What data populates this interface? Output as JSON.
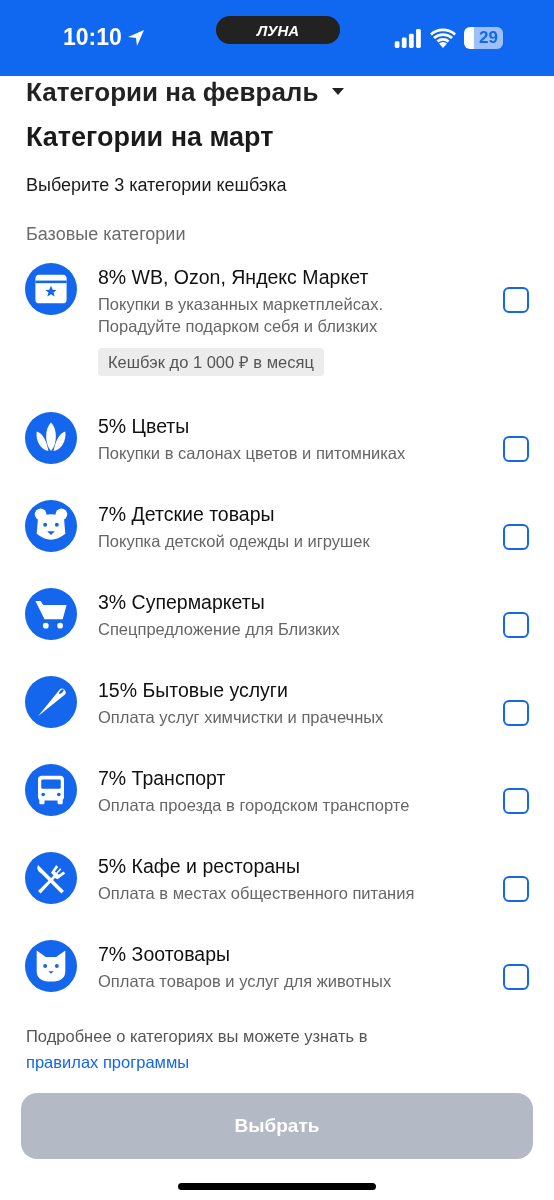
{
  "status_bar": {
    "time": "10:10",
    "carrier_logo": "ЛУНА",
    "battery": "29"
  },
  "previous_section": {
    "title": "Категории на февраль",
    "expanded": false
  },
  "title": "Категории на март",
  "subtitle": "Выберите 3 категории кешбэка",
  "section_label": "Базовые категории",
  "categories": [
    {
      "title": "8% WB, Ozon, Яндекс Маркет",
      "description": "Покупки в указанных маркетплейсах. Порадуйте подарком себя и близких",
      "badge": "Кешбэк до 1 000 ₽ в месяц",
      "checked": false
    },
    {
      "title": "5% Цветы",
      "description": "Покупки в салонах цветов и питомниках",
      "checked": false
    },
    {
      "title": "7% Детские товары",
      "description": "Покупка детской одежды и игрушек",
      "checked": false
    },
    {
      "title": "3% Супермаркеты",
      "description": "Спецпредложение для Близких",
      "checked": false
    },
    {
      "title": "15% Бытовые услуги",
      "description": "Оплата услуг химчистки и прачечных",
      "checked": false
    },
    {
      "title": "7% Транспорт",
      "description": "Оплата проезда в городском транспорте",
      "checked": false
    },
    {
      "title": "5% Кафе и рестораны",
      "description": "Оплата в местах общественного питания",
      "checked": false
    },
    {
      "title": "7% Зоотовары",
      "description": "Оплата товаров и услуг для животных",
      "checked": false
    }
  ],
  "footer_note": "Подробнее о категориях вы можете узнать в",
  "footer_link": "правилах программы",
  "submit_button": {
    "label": "Выбрать",
    "disabled": true
  }
}
